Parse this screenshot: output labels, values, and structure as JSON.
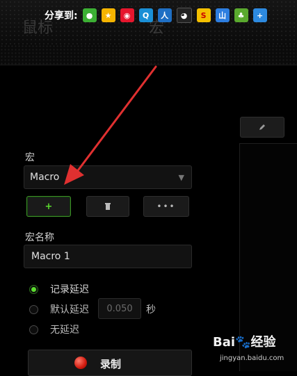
{
  "header": {
    "nav_mouse": "鼠标",
    "nav_macro": "宏"
  },
  "share": {
    "label": "分享到:",
    "icons": [
      {
        "name": "wechat-icon",
        "glyph": "●",
        "color": "#3cb034"
      },
      {
        "name": "qzone-icon",
        "glyph": "★",
        "color": "#f5b400"
      },
      {
        "name": "weibo-icon",
        "glyph": "◉",
        "color": "#e6162d"
      },
      {
        "name": "tencent-weibo-icon",
        "glyph": "Q",
        "color": "#1a8fd6"
      },
      {
        "name": "renren-icon",
        "glyph": "人",
        "color": "#1f6fc4"
      },
      {
        "name": "qq-icon",
        "glyph": "◕",
        "color": "#222222"
      },
      {
        "name": "sohu-icon",
        "glyph": "S",
        "color": "#f4c000"
      },
      {
        "name": "baidu-icon",
        "glyph": "山",
        "color": "#2d7ee0"
      },
      {
        "name": "kaixin-icon",
        "glyph": "♣",
        "color": "#5aa92e"
      },
      {
        "name": "more-share-icon",
        "glyph": "+",
        "color": "#2d8ae0"
      }
    ]
  },
  "macro": {
    "section_label": "宏",
    "selected": "Macro",
    "name_label": "宏名称",
    "name_value": "Macro 1"
  },
  "delay": {
    "options": [
      "记录延迟",
      "默认延迟",
      "无延迟"
    ],
    "selected_index": 0,
    "default_value": "0.050",
    "unit": "秒"
  },
  "record": {
    "label": "录制"
  },
  "watermark": {
    "brand_a": "Bai",
    "brand_b": "经验",
    "url": "jingyan.baidu.com"
  },
  "colors": {
    "accent": "#5bdc2e",
    "annotation": "#e03030",
    "record": "#d11a0e"
  }
}
